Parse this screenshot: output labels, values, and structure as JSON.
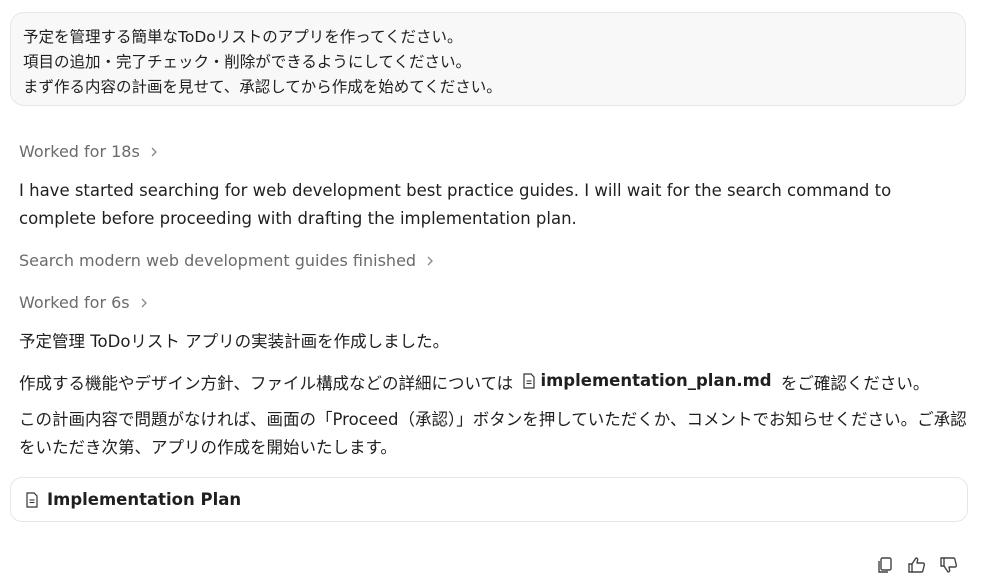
{
  "user_message": {
    "lines": [
      "予定を管理する簡単なToDoリストのアプリを作ってください。",
      "項目の追加・完了チェック・削除ができるようにしてください。",
      "まず作る内容の計画を見せて、承認してから作成を始めてください。"
    ]
  },
  "assistant": {
    "worked_1": "Worked for 18s",
    "text_1": "I have started searching for web development best practice guides. I will wait for the search command to complete before proceeding with drafting the implementation plan.",
    "search_status": "Search modern web development guides finished",
    "worked_2": "Worked for 6s",
    "text_2": "予定管理 ToDoリスト アプリの実装計画を作成しました。",
    "text_3_prefix": "作成する機能やデザイン方針、ファイル構成などの詳細については",
    "text_3_file": "implementation_plan.md",
    "text_3_suffix": "をご確認ください。",
    "text_4": "この計画内容で問題がなければ、画面の「Proceed（承認）」ボタンを押していただくか、コメントでお知らせください。ご承認をいただき次第、アプリの作成を開始いたします。"
  },
  "plan_card": {
    "title": "Implementation Plan",
    "icon": "document-icon"
  },
  "actions": {
    "icons": [
      "copy-icon",
      "thumbs-up-icon",
      "thumbs-down-icon"
    ]
  }
}
